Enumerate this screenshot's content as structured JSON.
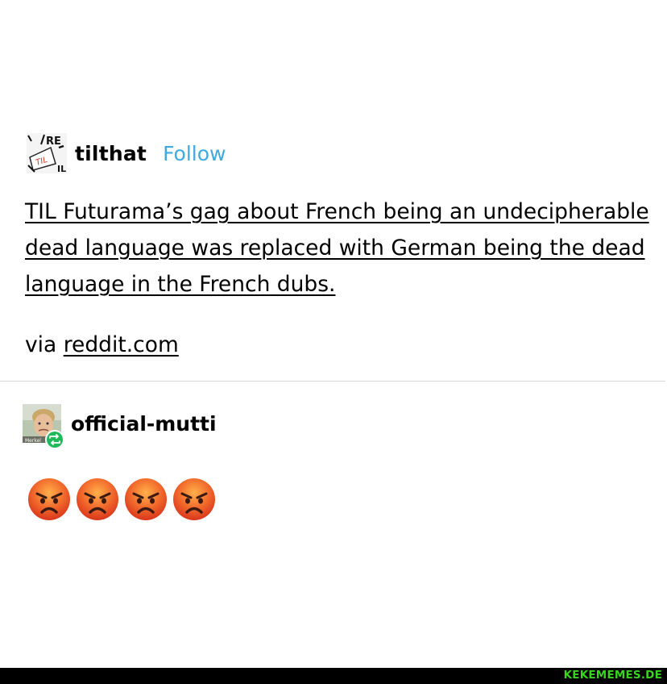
{
  "post": {
    "username": "tilthat",
    "follow_label": "Follow",
    "avatar_text": "TIL",
    "avatar_corner_text": "RE",
    "body_text": "TIL Futurama’s gag about French being an undecipherable dead language was replaced with German being the dead language in the French dubs.",
    "via_prefix": "via",
    "via_link": "reddit.com"
  },
  "reblog": {
    "username": "official-mutti",
    "avatar_caption": "Merkel",
    "emojis": [
      "angry-face-icon",
      "angry-face-icon",
      "angry-face-icon",
      "angry-face-icon"
    ]
  },
  "colors": {
    "follow": "#40a9e0",
    "reblog_badge": "#1fb85a",
    "watermark": "#39d51e"
  },
  "watermark": "KEKEMEMES.DE"
}
